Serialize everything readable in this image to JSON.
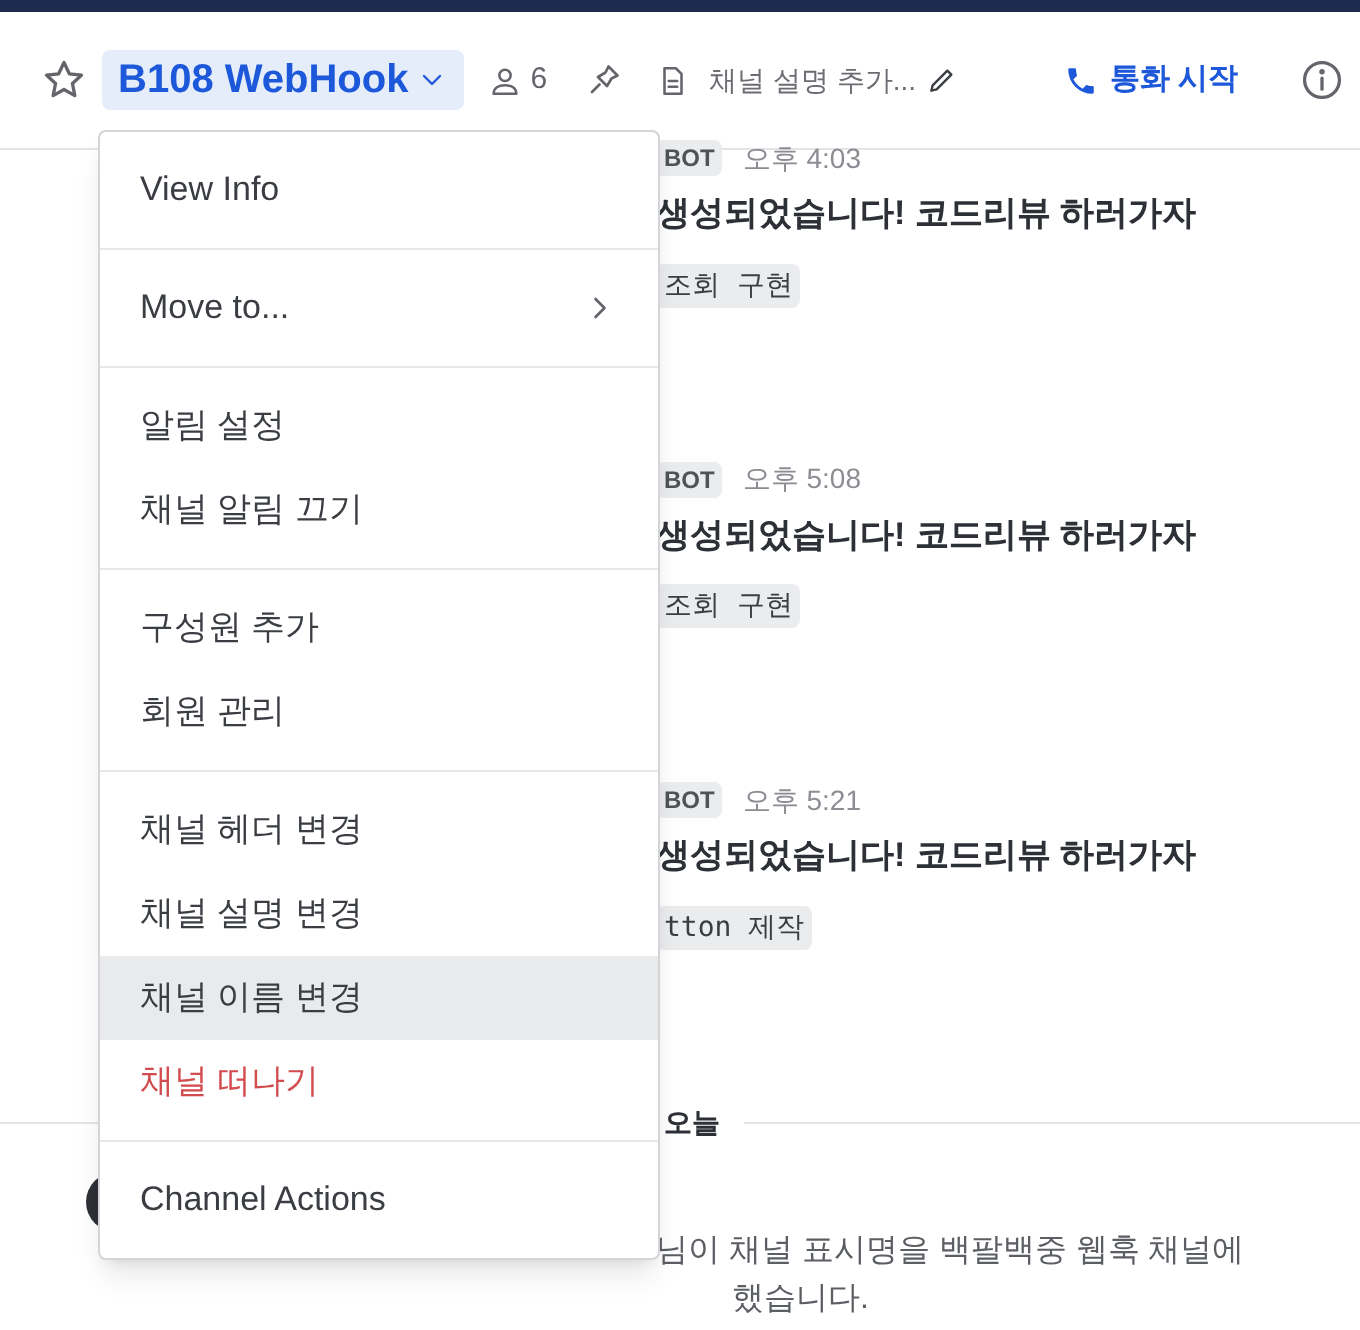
{
  "header": {
    "channel_name": "B108 WebHook",
    "member_count": "6",
    "description_placeholder": "채널 설명 추가...",
    "call_button": "통화 시작"
  },
  "messages": [
    {
      "badge": "BOT",
      "time": "오후 4:03",
      "text": "생성되었습니다! 코드리뷰 하러가자",
      "tag": "조회 구현"
    },
    {
      "badge": "BOT",
      "time": "오후 5:08",
      "text": "생성되었습니다! 코드리뷰 하러가자",
      "tag": "조회 구현"
    },
    {
      "badge": "BOT",
      "time": "오후 5:21",
      "text": "생성되었습니다! 코드리뷰 하러가자",
      "tag": "tton 제작"
    }
  ],
  "date_divider": "오늘",
  "system_message": {
    "line_1": "님이 채널 표시명을 백팔백중 웹훅 채널에",
    "line_2": "했습니다."
  },
  "menu": {
    "groups": [
      [
        {
          "label": "View Info",
          "kind": "item",
          "selected": false
        }
      ],
      [
        {
          "label": "Move to...",
          "kind": "submenu",
          "selected": false
        }
      ],
      [
        {
          "label": "알림 설정",
          "kind": "item",
          "selected": false
        },
        {
          "label": "채널 알림 끄기",
          "kind": "item",
          "selected": false
        }
      ],
      [
        {
          "label": "구성원 추가",
          "kind": "item",
          "selected": false
        },
        {
          "label": "회원 관리",
          "kind": "item",
          "selected": false
        }
      ],
      [
        {
          "label": "채널 헤더 변경",
          "kind": "item",
          "selected": false
        },
        {
          "label": "채널 설명 변경",
          "kind": "item",
          "selected": false
        },
        {
          "label": "채널 이름 변경",
          "kind": "item",
          "selected": true
        },
        {
          "label": "채널 떠나기",
          "kind": "danger",
          "selected": false
        }
      ],
      [
        {
          "label": "Channel Actions",
          "kind": "item",
          "selected": false
        }
      ]
    ]
  }
}
